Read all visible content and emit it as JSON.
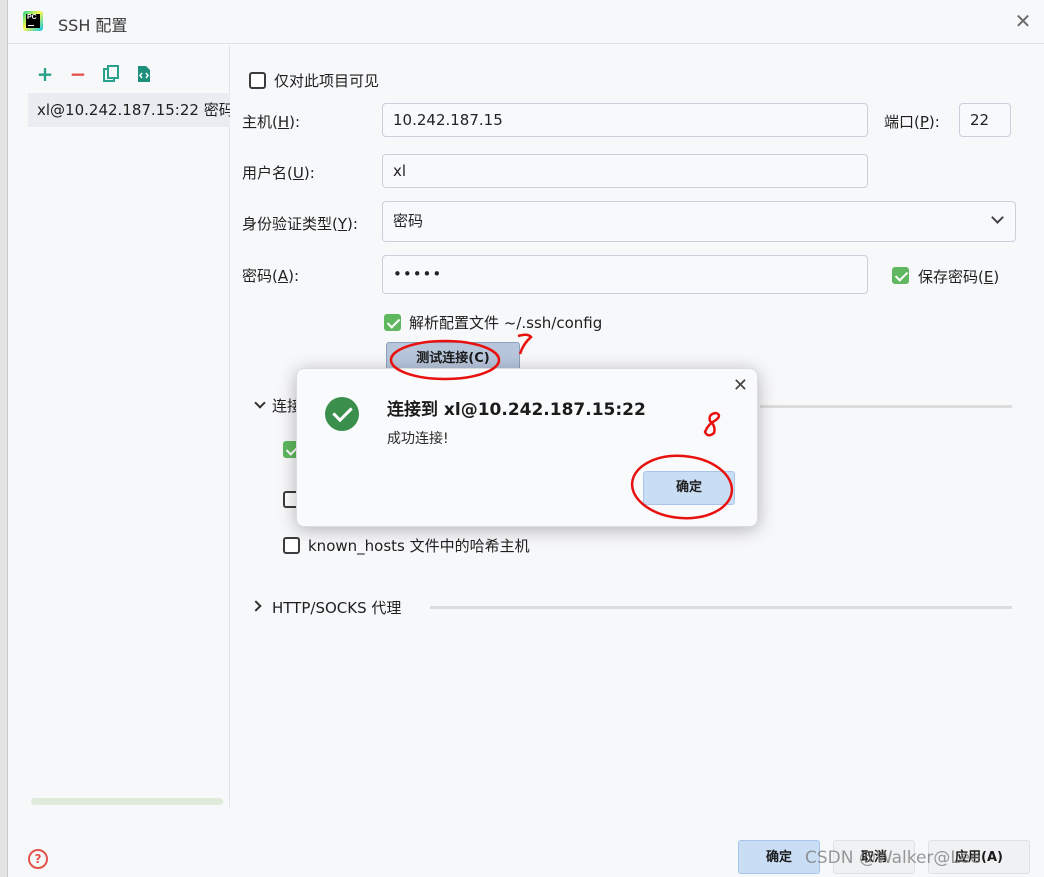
{
  "window": {
    "title": "SSH 配置",
    "close_glyph": "✕"
  },
  "left_panel": {
    "tools": [
      "add-icon",
      "remove-icon",
      "copy-icon",
      "export-icon"
    ],
    "connections": [
      {
        "label": "xl@10.242.187.15:22 密码"
      }
    ]
  },
  "form": {
    "visible_only_label": "仅对此项目可见",
    "host": {
      "label_pre": "主机(",
      "mnemonic": "H",
      "label_post": "):",
      "value": "10.242.187.15"
    },
    "port": {
      "label_pre": "端口(",
      "mnemonic": "P",
      "label_post": "):",
      "value": "22"
    },
    "username": {
      "label_pre": "用户名(",
      "mnemonic": "U",
      "label_post": "):",
      "value": "xl"
    },
    "auth_type": {
      "label_pre": "身份验证类型(",
      "mnemonic": "Y",
      "label_post": "):",
      "value": "密码"
    },
    "password": {
      "label_pre": "密码(",
      "mnemonic": "A",
      "label_post": "):",
      "value": "•••••"
    },
    "save_password": {
      "label_pre": "保存密码(",
      "mnemonic": "E",
      "label_post": ")",
      "checked": true
    },
    "parse_config": {
      "label": "解析配置文件 ~/.ssh/config",
      "checked": true
    },
    "test_button": "测试连接(C)",
    "section_connection": "连接",
    "section_opt1_checked": true,
    "section_opt2_checked": false,
    "known_hosts_label": "known_hosts 文件中的哈希主机",
    "section_proxy": "HTTP/SOCKS 代理"
  },
  "dialog": {
    "title": "连接到 xl@10.242.187.15:22",
    "message": "成功连接!",
    "ok_button": "确定",
    "close_glyph": "✕"
  },
  "footer": {
    "help_glyph": "?",
    "ok_button": "确定",
    "cancel_button": "取消",
    "apply_button": "应用(A)",
    "watermark": "CSDN @Walker@Lee"
  },
  "annotations": {
    "mark1": "7",
    "mark2": "8",
    "ink_color": "#e8110f"
  },
  "colors": {
    "accent_green": "#5fb85f",
    "success_green": "#3a8f4d",
    "primary_button": "#c9def5"
  }
}
